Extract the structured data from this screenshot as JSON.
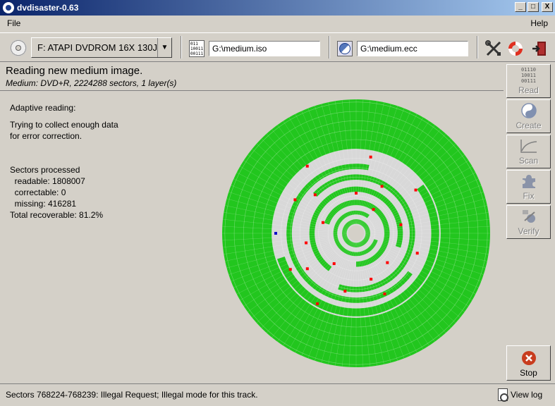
{
  "window": {
    "title": "dvdisaster-0.63",
    "minimize": "_",
    "maximize": "□",
    "close": "X"
  },
  "menu": {
    "file": "File",
    "help": "Help"
  },
  "toolbar": {
    "drive": "F:  ATAPI DVDROM 16X 130J",
    "image_path": "G:\\medium.iso",
    "ecc_path": "G:\\medium.ecc",
    "image_icon_text": "011\n10011\n00111"
  },
  "status": {
    "main": "Reading new medium image.",
    "sub": "Medium: DVD+R, 2224288 sectors, 1 layer(s)"
  },
  "info": {
    "mode": "Adaptive reading:",
    "desc1": "Trying to collect enough data",
    "desc2": "for error correction.",
    "sectors_title": "Sectors processed",
    "readable": "  readable: 1808007",
    "correctable": "  correctable: 0",
    "missing": "  missing: 416281",
    "total": "Total recoverable: 81.2%"
  },
  "sidebar": {
    "read": "Read",
    "read_icon_text": "01110\n10011\n00111",
    "create": "Create",
    "scan": "Scan",
    "fix": "Fix",
    "verify": "Verify",
    "stop": "Stop"
  },
  "bottom": {
    "message": "Sectors 768224-768239: Illegal Request; Illegal mode for this track.",
    "view_log": "View log"
  },
  "colors": {
    "readable": "#22c61e",
    "unread": "#d8d8d8",
    "error": "#ff0000",
    "current": "#1010c8",
    "stop": "#c83c1e"
  },
  "disc": {
    "rings": [
      {
        "inner": 0.07,
        "outer": 0.105,
        "from": 0.0,
        "to": 1.0,
        "state": "readable"
      },
      {
        "inner": 0.14,
        "outer": 0.17,
        "from": 0.05,
        "to": 0.85,
        "state": "readable"
      },
      {
        "inner": 0.21,
        "outer": 0.25,
        "from": 0.55,
        "to": 1.25,
        "state": "readable"
      },
      {
        "inner": 0.31,
        "outer": 0.35,
        "from": 0.35,
        "to": 1.05,
        "state": "readable"
      },
      {
        "inner": 0.4,
        "outer": 0.44,
        "from": 0.62,
        "to": 1.3,
        "state": "readable"
      },
      {
        "inner": 0.48,
        "outer": 0.52,
        "from": 0.1,
        "to": 0.78,
        "state": "readable"
      },
      {
        "inner": 0.56,
        "outer": 0.62,
        "from": 0.9,
        "to": 1.45,
        "state": "readable"
      },
      {
        "inner": 0.63,
        "outer": 1.0,
        "from": 0.0,
        "to": 1.0,
        "state": "readable"
      }
    ],
    "errors": [
      [
        0.32,
        0.12
      ],
      [
        0.45,
        0.4
      ],
      [
        0.3,
        0.75
      ],
      [
        0.55,
        0.9
      ],
      [
        0.36,
        0.2
      ],
      [
        0.26,
        0.55
      ],
      [
        0.42,
        0.62
      ],
      [
        0.6,
        0.33
      ],
      [
        0.48,
        0.05
      ],
      [
        0.38,
        0.47
      ],
      [
        0.52,
        0.58
      ],
      [
        0.22,
        0.85
      ],
      [
        0.58,
        0.78
      ],
      [
        0.44,
        0.28
      ],
      [
        0.34,
        0.97
      ],
      [
        0.62,
        0.65
      ],
      [
        0.4,
        0.83
      ],
      [
        0.28,
        0.35
      ],
      [
        0.5,
        0.18
      ],
      [
        0.56,
        0.42
      ]
    ],
    "current": [
      0.6,
      0.5
    ]
  }
}
